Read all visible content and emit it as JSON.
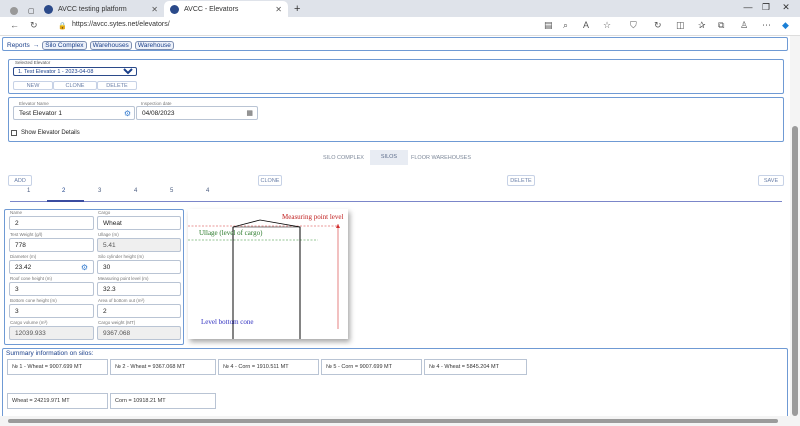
{
  "browser": {
    "tabs": [
      {
        "title": "AVCC testing platform"
      },
      {
        "title": "AVCC - Elevators"
      }
    ],
    "new_tab": "+",
    "url": "https://avcc.sytes.net/elevators/",
    "window_controls": [
      "—",
      "❐",
      "✕"
    ]
  },
  "breadcrumb": {
    "root": "Reports",
    "separator": "→",
    "items": [
      "Silo Complex",
      "Warehouses",
      "Warehouse"
    ]
  },
  "elevator_select": {
    "legend": "Selected Elevator",
    "value": "1. Test Elevator 1 - 2023-04-08",
    "buttons": [
      "NEW",
      "CLONE",
      "DELETE"
    ]
  },
  "elevator_info": {
    "name_label": "Elevator Name",
    "name_value": "Test Elevator 1",
    "date_label": "Inspection date",
    "date_value": "04/08/2023",
    "details_label": "Show Elevator Details"
  },
  "section_tabs": [
    "SILO COMPLEX",
    "SILOS",
    "FLOOR WAREHOUSES"
  ],
  "silos_toolbar": {
    "add": "ADD",
    "clone": "CLONE",
    "delete": "DELETE",
    "save": "SAVE"
  },
  "silo_tabs": [
    "1",
    "2",
    "3",
    "4",
    "5",
    "4"
  ],
  "active_silo_tab": 1,
  "silo_form": {
    "name_label": "Name",
    "name_value": "2",
    "cargo_label": "Cargo",
    "cargo_value": "Wheat",
    "test_weight_label": "Test Weight (g/l)",
    "test_weight_value": "778",
    "ullage_label": "Ullage (m)",
    "ullage_value": "5.41",
    "diameter_label": "Diameter (m)",
    "diameter_value": "23.42",
    "cyl_height_label": "Silo cylinder height (m)",
    "cyl_height_value": "30",
    "roof_cone_label": "Roof cone height (m)",
    "roof_cone_value": "3",
    "mpl_label": "Measuring point level (m)",
    "mpl_value": "32.3",
    "bottom_cone_label": "Bottom cone height (m)",
    "bottom_cone_value": "3",
    "bottom_out_label": "Area of bottom out (m²)",
    "bottom_out_value": "2",
    "cargo_volume_label": "Cargo volume (m³)",
    "cargo_volume_value": "12039.933",
    "cargo_weight_label": "Cargo weight (MT)",
    "cargo_weight_value": "9367.068"
  },
  "diagram": {
    "measuring_point": "Measuring point level",
    "ullage": "Ullage (level of cargo)",
    "bottom_cone": "Level bottom cone"
  },
  "summary": {
    "title": "Summary information on silos:",
    "silos": [
      "№ 1 - Wheat = 9007.699 MT",
      "№ 2 - Wheat = 9367.068 MT",
      "№ 4 - Corn = 1910.511 MT",
      "№ 5 - Corn = 9007.699 MT",
      "№ 4 - Wheat = 5845.204 MT"
    ],
    "totals": [
      "Wheat = 24219.971 MT",
      "Corn = 10918.21 MT"
    ]
  },
  "colors": {
    "accent": "#1a3f8a",
    "border": "#6f9ad4",
    "cargo_line": "#2a8a2a",
    "measure_line": "#d23030"
  }
}
